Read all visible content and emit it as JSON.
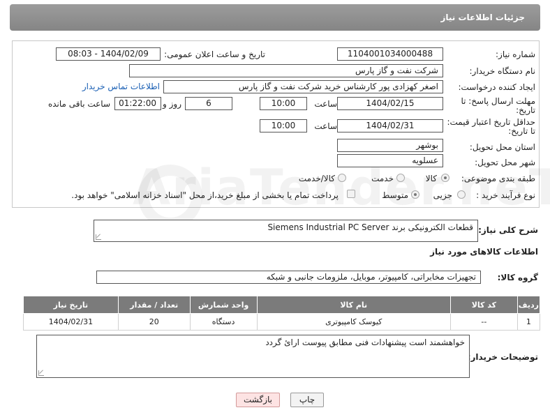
{
  "header": {
    "title": "جزئیات اطلاعات نیاز"
  },
  "form": {
    "need_number": {
      "label": "شماره نیاز:",
      "value": "1104001034000488"
    },
    "announce": {
      "label": "تاریخ و ساعت اعلان عمومی:",
      "value": "1404/02/09 - 08:03"
    },
    "buyer_org": {
      "label": "نام دستگاه خریدار:",
      "value": "شرکت نفت و گاز پارس"
    },
    "creator": {
      "label": "ایجاد کننده درخواست:",
      "value": "اصغر کهزادی پور کارشناس خرید شرکت نفت و گاز پارس",
      "contact_link": "اطلاعات تماس خریدار"
    },
    "reply_deadline": {
      "label_line1": "مهلت ارسال پاسخ: تا",
      "label_line2": "تاریخ:",
      "date": "1404/02/15",
      "time_label": "ساعت",
      "time": "10:00",
      "days": "6",
      "days_label": "روز و",
      "remaining": "01:22:00",
      "remaining_label": "ساعت باقی مانده"
    },
    "price_validity": {
      "label_line1": "حداقل تاریخ اعتبار قیمت:",
      "label_line2": "تا تاریخ:",
      "date": "1404/02/31",
      "time_label": "ساعت",
      "time": "10:00"
    },
    "province": {
      "label": "استان محل تحویل:",
      "value": "بوشهر"
    },
    "city": {
      "label": "شهر محل تحویل:",
      "value": "عسلویه"
    },
    "category": {
      "label": "طبقه بندی موضوعی:",
      "options": [
        {
          "label": "کالا",
          "selected": true
        },
        {
          "label": "خدمت",
          "selected": false
        },
        {
          "label": "کالا/خدمت",
          "selected": false
        }
      ]
    },
    "process": {
      "label": "نوع فرآیند خرید :",
      "options": [
        {
          "label": "جزیی",
          "selected": false
        },
        {
          "label": "متوسط",
          "selected": true
        }
      ],
      "payment_note": "پرداخت تمام یا بخشی از مبلغ خرید،از محل \"اسناد خزانه اسلامی\" خواهد بود."
    }
  },
  "summary": {
    "label": "شرح کلی نیاز:",
    "value": "قطعات الکترونیکی برند Siemens Industrial PC Server"
  },
  "goods_section": {
    "title": "اطلاعات کالاهای مورد نیاز"
  },
  "goods_group": {
    "label": "گروه کالا:",
    "value": "تجهیزات مخابراتی، کامپیوتر، موبایل، ملزومات جانبی و شبکه"
  },
  "table": {
    "headers": [
      "ردیف",
      "کد کالا",
      "نام کالا",
      "واحد شمارش",
      "تعداد / مقدار",
      "تاریخ نیاز"
    ],
    "rows": [
      [
        "1",
        "--",
        "کیوسک کامپیوتری",
        "دستگاه",
        "20",
        "1404/02/31"
      ]
    ]
  },
  "buyer_notes": {
    "label": "توضیحات خریدار:",
    "value": "خواهشمند است پیشنهادات فنی مطابق پیوست ارائ گردد"
  },
  "buttons": {
    "print": "چاپ",
    "back": "بازگشت"
  },
  "watermark": {
    "text": "AriaTender.neT"
  }
}
